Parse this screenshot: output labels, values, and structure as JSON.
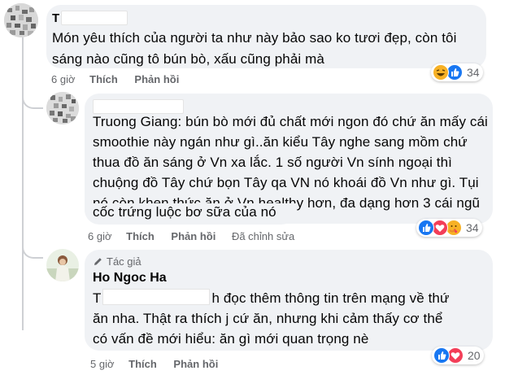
{
  "comments": [
    {
      "name": "T",
      "text_lines": [
        "Món yêu thích của người ta như này bảo sao ko tươi đẹp, còn tôi",
        "sáng nào cũng tô bún bò, xấu cũng phải mà"
      ],
      "time": "6 giờ",
      "like_label": "Thích",
      "reply_label": "Phản hồi",
      "reaction_count": "34",
      "reactions": [
        "haha",
        "like"
      ]
    },
    {
      "name": "",
      "text_lines": [
        "Truong Giang: bún bò mới đủ chất mới ngon đó chứ ăn mấy cái",
        "smoothie này ngán như gì..ăn kiểu Tây nghe sang mồm chứ",
        "thua đồ ăn sáng ở Vn xa lắc. 1 số người Vn sính ngoại thì",
        "chuộng đồ Tây chứ bọn Tây qa VN nó khoái đồ Vn như gì. Tụi",
        "nó còn khen thức ăn ở Vn healthy hơn, đa dạng hơn 3 cái ngũ",
        "cốc trứng luộc bơ sữa của nó"
      ],
      "time": "6 giờ",
      "like_label": "Thích",
      "reply_label": "Phản hồi",
      "edited_label": "Đã chỉnh sửa",
      "reaction_count": "34",
      "reactions": [
        "like",
        "love",
        "care"
      ]
    },
    {
      "author_badge": "Tác giả",
      "name": "Ho Ngoc Ha",
      "text_lines": [
        "T",
        "h đọc thêm thông tin trên mạng về thứ",
        "ăn nha. Thật ra thích j cứ ăn, nhưng khi cảm thấy cơ thể",
        "có vấn đề mới hiểu: ăn gì mới quan trọng nè"
      ],
      "time": "5 giờ",
      "like_label": "Thích",
      "reply_label": "Phản hồi",
      "reaction_count": "20",
      "reactions": [
        "like",
        "love"
      ]
    }
  ],
  "colors": {
    "bubble": "#f0f2f5",
    "meta_text": "#65676b",
    "like_blue": "#1877f2",
    "love_red": "#f33e58",
    "haha_yellow": "#f7b125"
  }
}
